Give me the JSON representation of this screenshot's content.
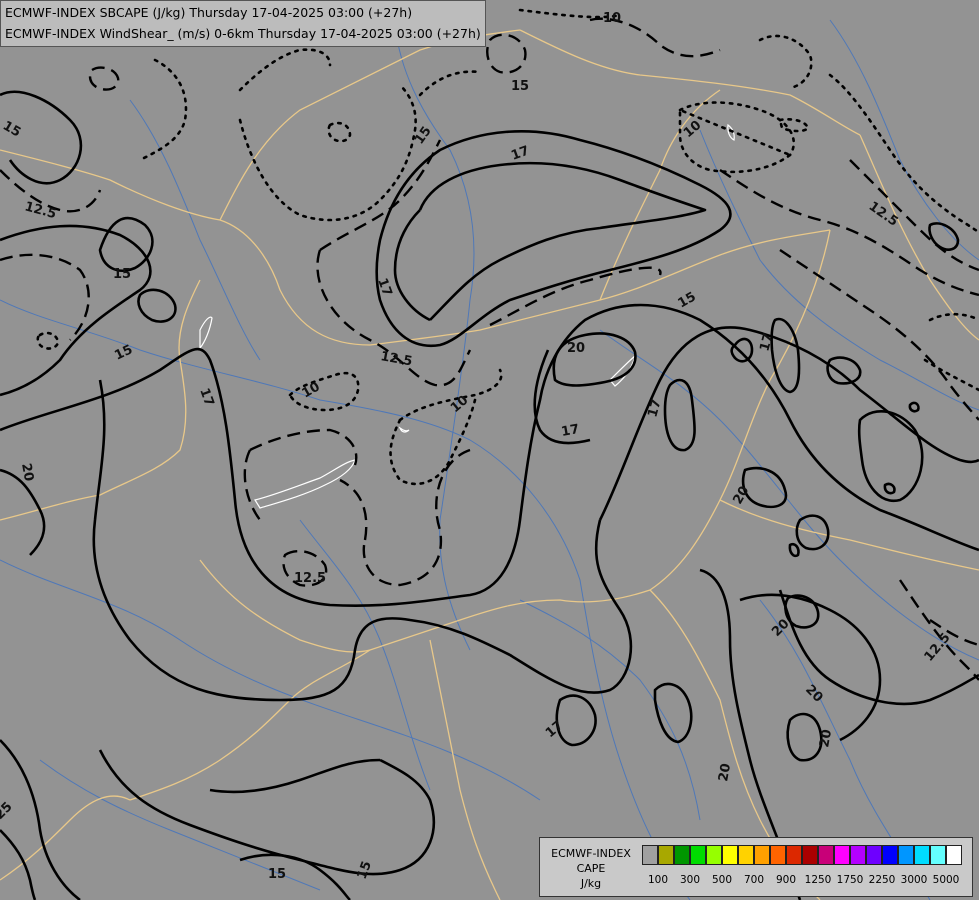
{
  "title": {
    "line1": "ECMWF-INDEX SBCAPE (J/kg) Thursday 17-04-2025 03:00 (+27h)",
    "line2": "ECMWF-INDEX WindShear_ (m/s) 0-6km Thursday 17-04-2025 03:00 (+27h)"
  },
  "map": {
    "background_color": "#939393",
    "border_color": "#e8c88a",
    "river_color": "#4f78b8",
    "contour_labels": [
      {
        "text": "10",
        "kind": "wind-shear"
      },
      {
        "text": "15",
        "kind": "wind-shear"
      },
      {
        "text": "10",
        "kind": "wind-shear"
      },
      {
        "text": "15",
        "kind": "wind-shear"
      },
      {
        "text": "17",
        "kind": "wind-shear"
      },
      {
        "text": "12.5",
        "kind": "wind-shear"
      },
      {
        "text": "12.5",
        "kind": "wind-shear"
      },
      {
        "text": "15",
        "kind": "wind-shear"
      },
      {
        "text": "15",
        "kind": "wind-shear"
      },
      {
        "text": "17",
        "kind": "wind-shear"
      },
      {
        "text": "15",
        "kind": "wind-shear"
      },
      {
        "text": "12.5",
        "kind": "wind-shear"
      },
      {
        "text": "20",
        "kind": "wind-shear"
      },
      {
        "text": "17",
        "kind": "wind-shear"
      },
      {
        "text": "10",
        "kind": "wind-shear"
      },
      {
        "text": "10",
        "kind": "wind-shear"
      },
      {
        "text": "17",
        "kind": "wind-shear"
      },
      {
        "text": "17",
        "kind": "wind-shear"
      },
      {
        "text": "17",
        "kind": "wind-shear"
      },
      {
        "text": "15",
        "kind": "wind-shear"
      },
      {
        "text": "20",
        "kind": "wind-shear"
      },
      {
        "text": "20",
        "kind": "wind-shear"
      },
      {
        "text": "12.5",
        "kind": "wind-shear"
      },
      {
        "text": "20",
        "kind": "wind-shear"
      },
      {
        "text": "20",
        "kind": "wind-shear"
      },
      {
        "text": "20",
        "kind": "wind-shear"
      },
      {
        "text": "12.5",
        "kind": "wind-shear"
      },
      {
        "text": "17",
        "kind": "wind-shear"
      },
      {
        "text": "20",
        "kind": "wind-shear"
      },
      {
        "text": "25",
        "kind": "wind-shear"
      },
      {
        "text": "15",
        "kind": "wind-shear"
      },
      {
        "text": "15",
        "kind": "wind-shear"
      }
    ]
  },
  "legend": {
    "model": "ECMWF-INDEX",
    "variable": "CAPE",
    "unit": "J/kg",
    "colors": [
      "#a0a0a0",
      "#a8a800",
      "#009600",
      "#00dc00",
      "#96ff00",
      "#ffff00",
      "#ffd200",
      "#ffa000",
      "#ff6400",
      "#dc2800",
      "#aa0000",
      "#c80078",
      "#ff00ff",
      "#b400ff",
      "#6e00ff",
      "#0000ff",
      "#0096ff",
      "#00dcff",
      "#64ffff",
      "#ffffff"
    ],
    "tick_labels": [
      "100",
      "300",
      "500",
      "700",
      "900",
      "1250",
      "1750",
      "2250",
      "3000",
      "5000"
    ]
  }
}
